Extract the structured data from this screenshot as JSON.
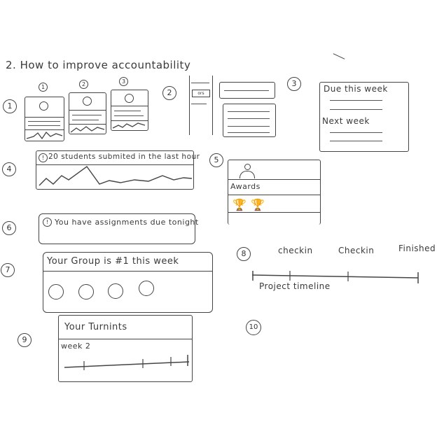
{
  "title": "2. How to improve accountability",
  "sections": {
    "s1": {
      "number": "1",
      "card_numbers": [
        "1",
        "2",
        "3"
      ]
    },
    "s2": {
      "number": "2",
      "sidebar_badge": "ors"
    },
    "s3": {
      "number": "3",
      "heading_this_week": "Due this week",
      "heading_next_week": "Next week"
    },
    "s4": {
      "number": "4",
      "alert_icon": "!",
      "message": "20 students submited in the last hour"
    },
    "s5": {
      "number": "5",
      "awards_label": "Awards"
    },
    "s6": {
      "number": "6",
      "alert_icon": "!",
      "message": "You have assignments due tonight"
    },
    "s7": {
      "number": "7",
      "message": "Your Group is #1 this week"
    },
    "s8": {
      "number": "8",
      "milestones": [
        "checkin",
        "Checkin",
        "Finished"
      ],
      "caption": "Project timeline"
    },
    "s9": {
      "number": "9",
      "heading": "Your Turnints",
      "week_label": "week 2"
    },
    "s10": {
      "number": "10"
    }
  }
}
